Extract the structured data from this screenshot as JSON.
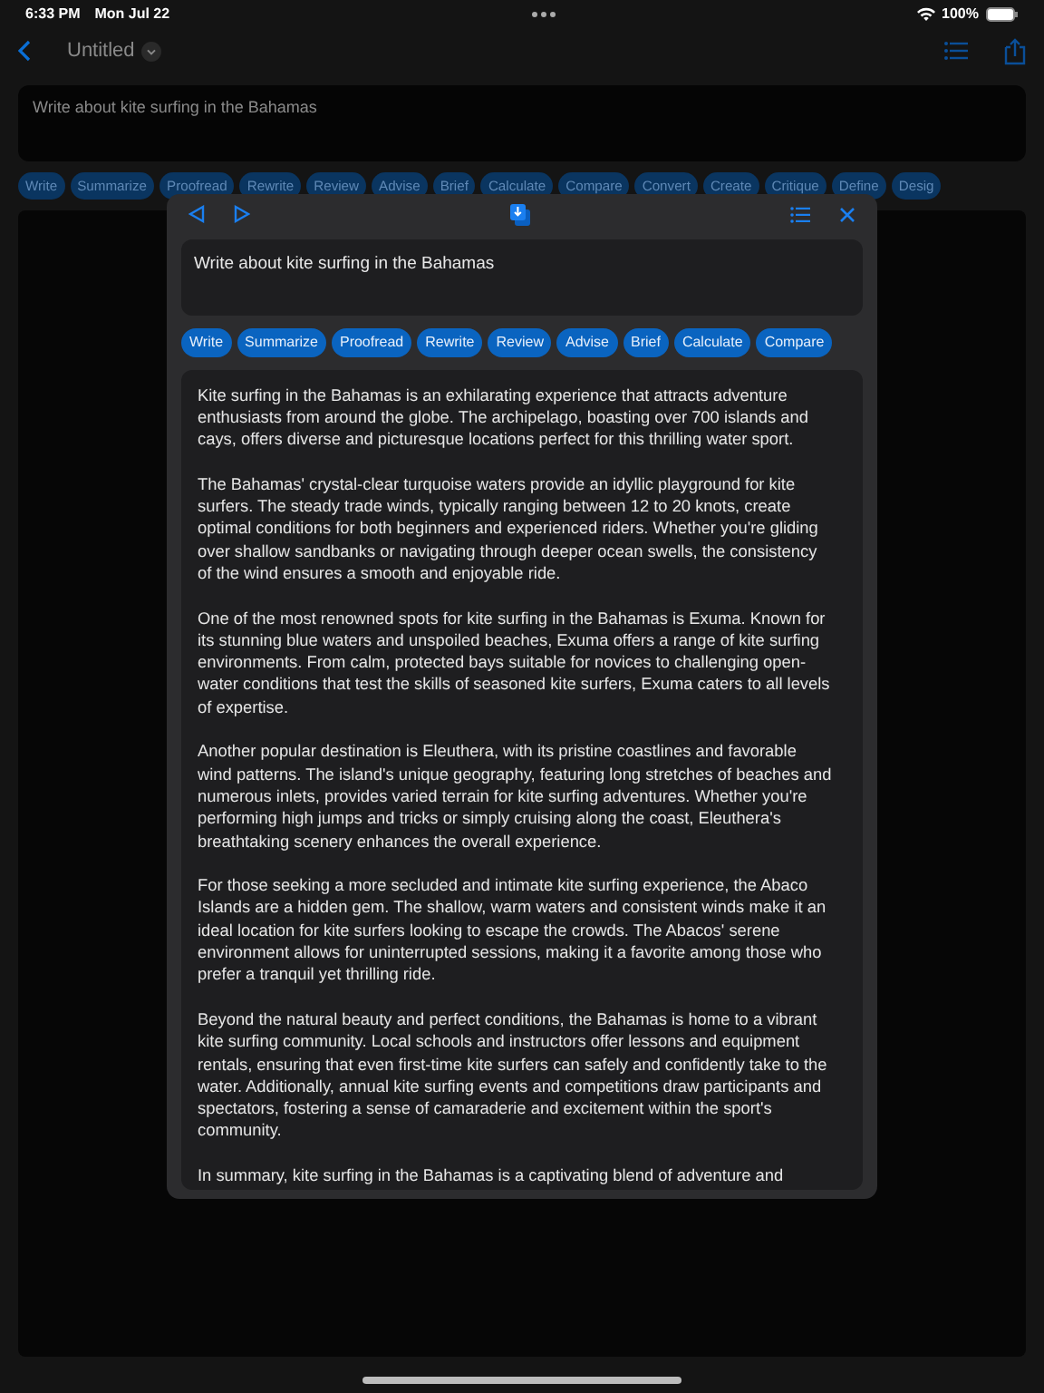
{
  "status_bar": {
    "time": "6:33 PM",
    "date": "Mon Jul 22",
    "battery": "100%"
  },
  "nav": {
    "title": "Untitled"
  },
  "prompt": {
    "value": "Write about kite surfing in the Bahamas"
  },
  "chips": [
    "Write",
    "Summarize",
    "Proofread",
    "Rewrite",
    "Review",
    "Advise",
    "Brief",
    "Calculate",
    "Compare",
    "Convert",
    "Create",
    "Critique",
    "Define",
    "Desig"
  ],
  "popup": {
    "prompt": {
      "value": "Write about kite surfing in the Bahamas"
    },
    "chips": [
      "Write",
      "Summarize",
      "Proofread",
      "Rewrite",
      "Review",
      "Advise",
      "Brief",
      "Calculate",
      "Compare"
    ],
    "paragraphs": [
      "Kite surfing in the Bahamas is an exhilarating experience that attracts adventure enthusiasts from around the globe. The archipelago, boasting over 700 islands and cays, offers diverse and picturesque locations perfect for this thrilling water sport.",
      "The Bahamas' crystal-clear turquoise waters provide an idyllic playground for kite surfers. The steady trade winds, typically ranging between 12 to 20 knots, create optimal conditions for both beginners and experienced riders. Whether you're gliding over shallow sandbanks or navigating through deeper ocean swells, the consistency of the wind ensures a smooth and enjoyable ride.",
      "One of the most renowned spots for kite surfing in the Bahamas is Exuma. Known for its stunning blue waters and unspoiled beaches, Exuma offers a range of kite surfing environments. From calm, protected bays suitable for novices to challenging open-water conditions that test the skills of seasoned kite surfers, Exuma caters to all levels of expertise.",
      "Another popular destination is Eleuthera, with its pristine coastlines and favorable wind patterns. The island's unique geography, featuring long stretches of beaches and numerous inlets, provides varied terrain for kite surfing adventures. Whether you're performing high jumps and tricks or simply cruising along the coast, Eleuthera's breathtaking scenery enhances the overall experience.",
      "For those seeking a more secluded and intimate kite surfing experience, the Abaco Islands are a hidden gem. The shallow, warm waters and consistent winds make it an ideal location for kite surfers looking to escape the crowds. The Abacos' serene environment allows for uninterrupted sessions, making it a favorite among those who prefer a tranquil yet thrilling ride.",
      "Beyond the natural beauty and perfect conditions, the Bahamas is home to a vibrant kite surfing community. Local schools and instructors offer lessons and equipment rentals, ensuring that even first-time kite surfers can safely and confidently take to the water. Additionally, annual kite surfing events and competitions draw participants and spectators, fostering a sense of camaraderie and excitement within the sport's community.",
      "In summary, kite surfing in the Bahamas is a captivating blend of adventure and"
    ]
  }
}
